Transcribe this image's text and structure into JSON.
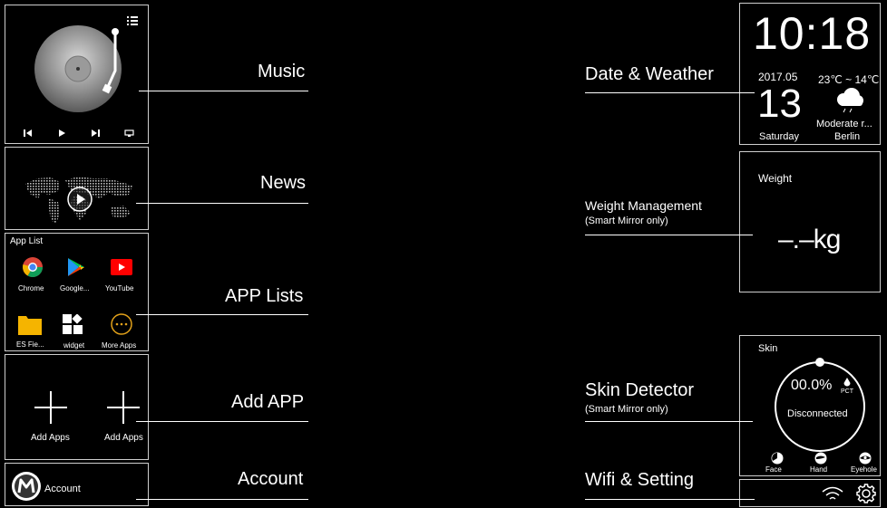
{
  "labels": {
    "music": "Music",
    "news": "News",
    "app_lists": "APP Lists",
    "add_app": "Add APP",
    "account": "Account",
    "date_weather": "Date & Weather",
    "weight_mgmt": "Weight Management",
    "weight_sub": "(Smart Mirror only)",
    "skin_detector": "Skin Detector",
    "skin_sub": "(Smart Mirror only)",
    "wifi_setting": "Wifi & Setting"
  },
  "app_list": {
    "title": "App List",
    "apps": [
      {
        "name": "Chrome",
        "icon": "chrome-icon"
      },
      {
        "name": "Google...",
        "icon": "google-play-icon"
      },
      {
        "name": "YouTube",
        "icon": "youtube-icon"
      },
      {
        "name": "ES Fie...",
        "icon": "folder-icon"
      },
      {
        "name": "widget",
        "icon": "widget-icon"
      },
      {
        "name": "More Apps",
        "icon": "more-apps-icon"
      }
    ]
  },
  "add_apps": {
    "left": "Add Apps",
    "right": "Add Apps"
  },
  "account_panel": {
    "label": "Account",
    "icon": "m-logo-icon"
  },
  "clock": {
    "time": "10:18",
    "year_month": "2017.05",
    "day": "13",
    "weekday": "Saturday",
    "temp": "23℃ ~ 14℃",
    "condition": "Moderate r...",
    "city": "Berlin"
  },
  "weight": {
    "title": "Weight",
    "value": "–.–kg"
  },
  "skin": {
    "title": "Skin",
    "percent": "00.0%",
    "unit": "PCT",
    "status": "Disconnected",
    "zones": [
      "Face",
      "Hand",
      "Eyehole"
    ]
  },
  "colors": {
    "panel_border": "#cfcfcf",
    "youtube_red": "#ff0000",
    "more_apps_gold": "#e3a21a",
    "folder_yellow": "#f5b400"
  }
}
